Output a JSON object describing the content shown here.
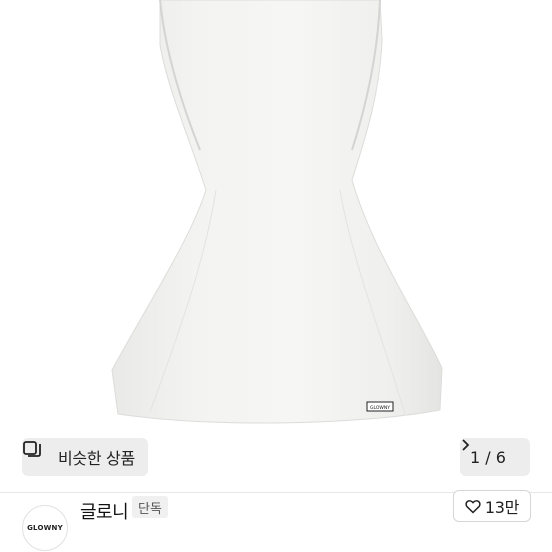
{
  "product_image": {
    "label_tag": "GLOWNY"
  },
  "similar_button": {
    "label": "비슷한 상품",
    "icon": "similar-items-icon"
  },
  "pager": {
    "text": "1 / 6",
    "icon": "chevron-right-icon"
  },
  "store": {
    "logo_text": "GLOWNY",
    "name": "글로니",
    "badge": "단독"
  },
  "like": {
    "count": "13만",
    "icon": "heart-icon"
  }
}
